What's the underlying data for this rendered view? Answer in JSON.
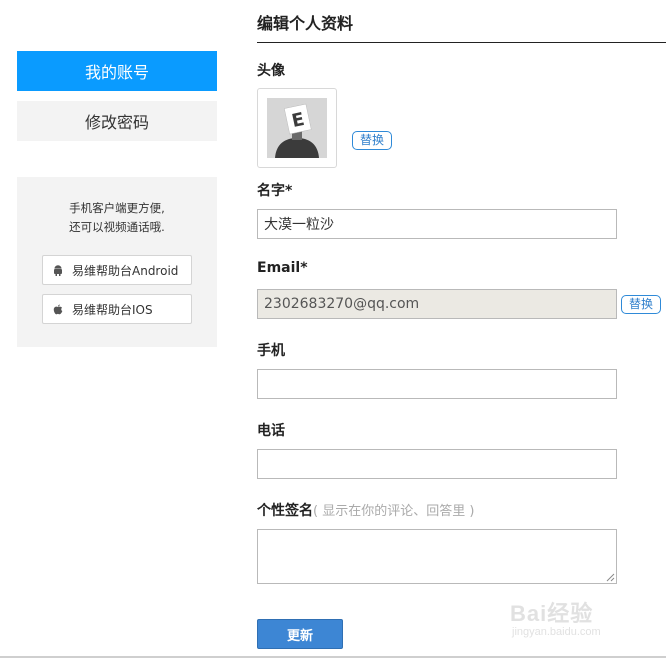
{
  "sidebar": {
    "nav": [
      {
        "label": "我的账号",
        "active": true
      },
      {
        "label": "修改密码",
        "active": false
      }
    ],
    "promo": {
      "line1": "手机客户端更方便,",
      "line2": "还可以视频通话哦.",
      "android_label": "易维帮助台Android",
      "ios_label": "易维帮助台IOS"
    }
  },
  "form": {
    "title": "编辑个人资料",
    "avatar": {
      "label": "头像",
      "replace_label": "替换"
    },
    "name": {
      "label": "名字*",
      "value": "大漠一粒沙"
    },
    "email": {
      "label": "Email*",
      "value": "2302683270@qq.com",
      "replace_label": "替换"
    },
    "mobile": {
      "label": "手机",
      "value": ""
    },
    "phone": {
      "label": "电话",
      "value": ""
    },
    "signature": {
      "label": "个性签名",
      "hint": "( 显示在你的评论、回答里 )",
      "value": ""
    },
    "submit_label": "更新"
  },
  "watermark": {
    "brand": "Bai经验",
    "sub": "jingyan.baidu.com"
  },
  "colors": {
    "accent": "#0a9bff",
    "button": "#3d86d4",
    "link": "#2f7fcc"
  }
}
